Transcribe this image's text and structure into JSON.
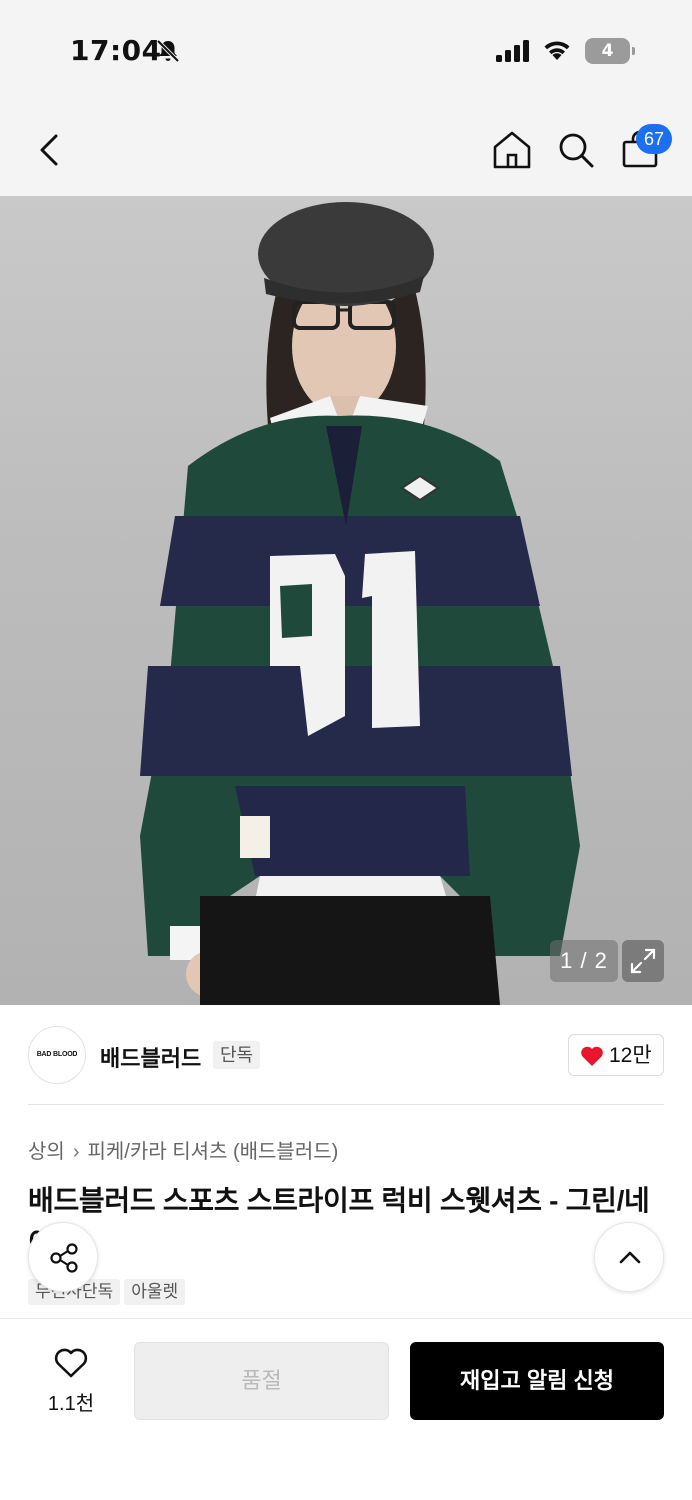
{
  "status_bar": {
    "time": "17:04",
    "battery": "4"
  },
  "header": {
    "cart_count": "67"
  },
  "gallery": {
    "counter": "1 / 2"
  },
  "brand": {
    "logo_text": "BAD BLOOD",
    "name": "배드블러드",
    "tag": "단독",
    "likes": "12만"
  },
  "breadcrumb": {
    "category": "상의",
    "subcategory": "피케/카라 티셔츠 (배드블러드)"
  },
  "product": {
    "title": "배드블러드 스포츠 스트라이프 럭비 스웻셔츠 - 그린/네이비",
    "tags": [
      "무신사단독",
      "아울렛"
    ]
  },
  "bottom_bar": {
    "wish_count": "1.1천",
    "soldout_label": "품절",
    "restock_label": "재입고 알림 신청"
  },
  "colors": {
    "accent_blue": "#1d6ff2",
    "heart_red": "#e8162b",
    "button_black": "#000000"
  }
}
